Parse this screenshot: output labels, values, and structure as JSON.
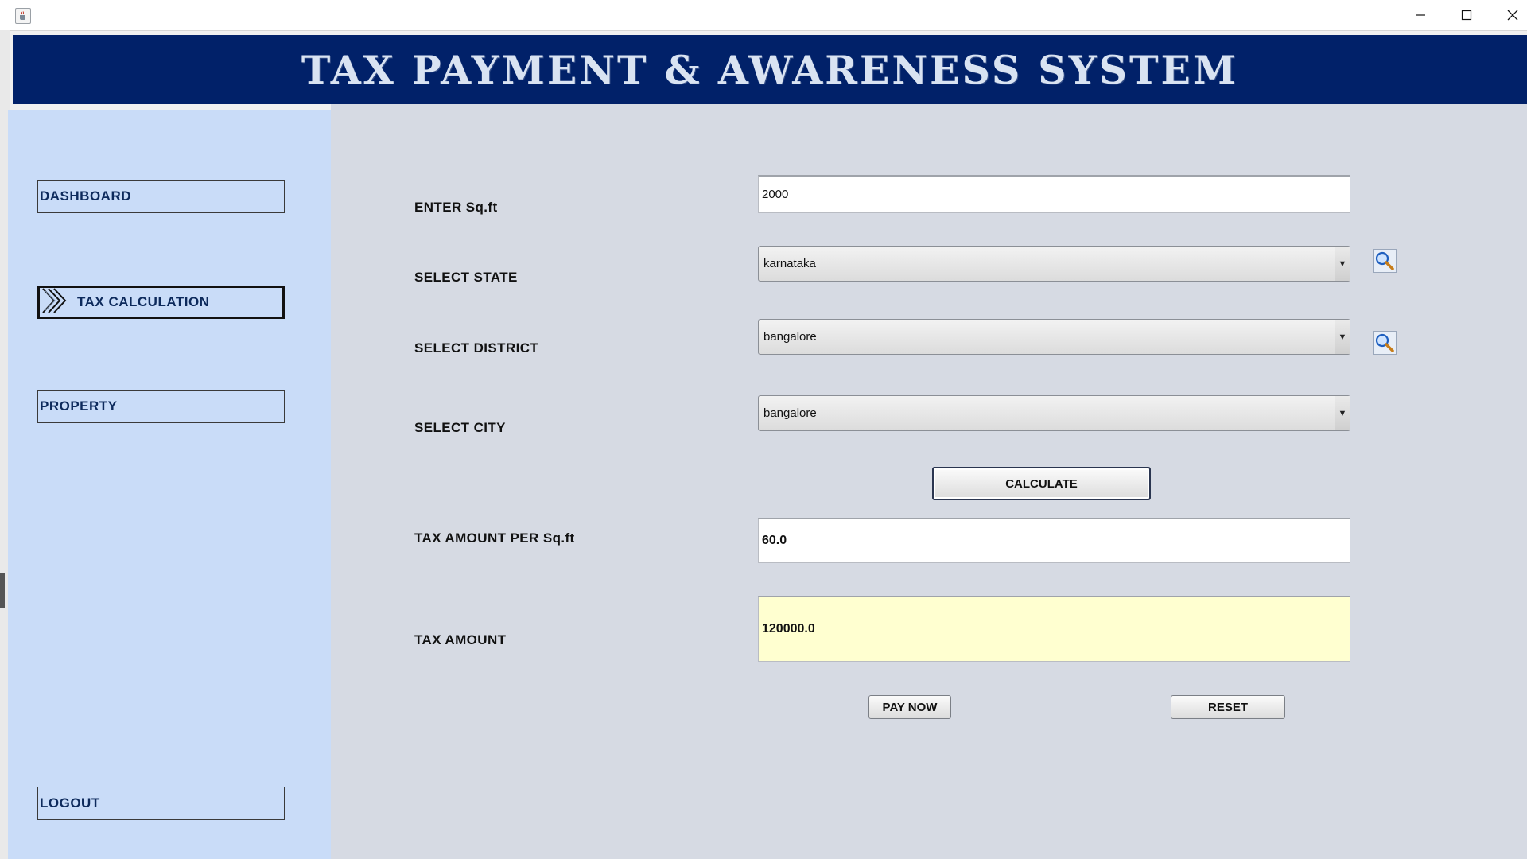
{
  "window": {
    "controls": {
      "minimize": "—",
      "maximize": "☐",
      "close": "✕"
    }
  },
  "header": {
    "title": "TAX PAYMENT & AWARENESS SYSTEM"
  },
  "sidebar": {
    "items": [
      {
        "label": "DASHBOARD",
        "active": false
      },
      {
        "label": "TAX CALCULATION",
        "active": true
      },
      {
        "label": "PROPERTY",
        "active": false
      },
      {
        "label": "LOGOUT",
        "active": false
      }
    ]
  },
  "form": {
    "sqft_label": "ENTER Sq.ft",
    "sqft_value": "2000",
    "state_label": "SELECT STATE",
    "state_value": "karnataka",
    "district_label": "SELECT DISTRICT",
    "district_value": "bangalore",
    "city_label": "SELECT CITY",
    "city_value": "bangalore",
    "calculate_label": "CALCULATE",
    "tax_per_sqft_label": "TAX AMOUNT PER Sq.ft",
    "tax_per_sqft_value": "60.0",
    "tax_amount_label": "TAX AMOUNT",
    "tax_amount_value": "120000.0",
    "pay_now_label": "PAY NOW",
    "reset_label": "RESET"
  },
  "colors": {
    "header_bg": "#012169",
    "sidebar_bg": "#c9dcf8",
    "content_bg": "#d6dae3",
    "tax_amount_bg": "#ffffd0"
  },
  "icons": {
    "app": "java-cup-icon",
    "nav_active": "chevron-right-icon",
    "search": "magnifier-icon"
  }
}
